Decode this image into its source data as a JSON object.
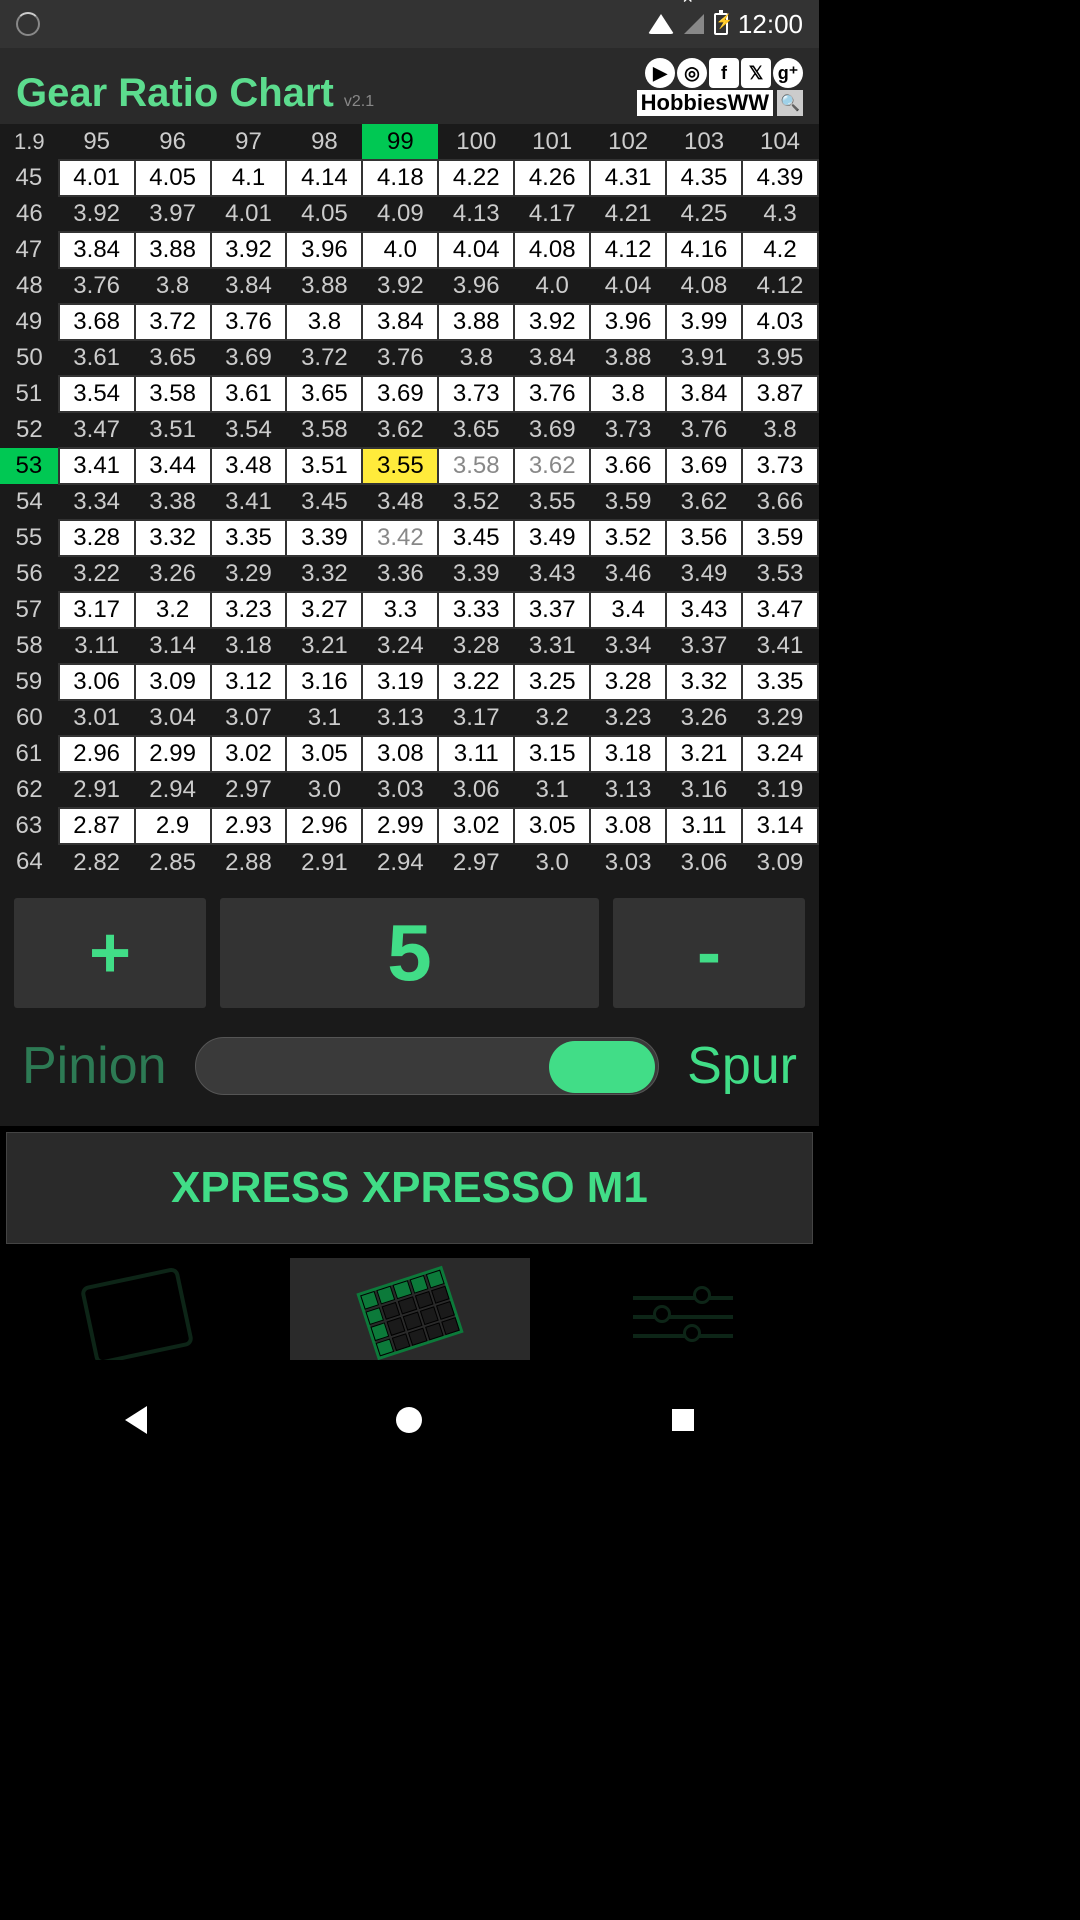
{
  "status": {
    "time": "12:00"
  },
  "header": {
    "title": "Gear Ratio Chart",
    "version": "v2.1",
    "brand": "HobbiesWW"
  },
  "table": {
    "corner": "1.9",
    "col_headers": [
      "95",
      "96",
      "97",
      "98",
      "99",
      "100",
      "101",
      "102",
      "103",
      "104"
    ],
    "highlight_col": 4,
    "row_headers": [
      "45",
      "46",
      "47",
      "48",
      "49",
      "50",
      "51",
      "52",
      "53",
      "54",
      "55",
      "56",
      "57",
      "58",
      "59",
      "60",
      "61",
      "62",
      "63",
      "64"
    ],
    "highlight_row": 8,
    "yellow_cell": {
      "row": 8,
      "col": 4
    },
    "gray_cells": [
      {
        "row": 8,
        "col": 5
      },
      {
        "row": 8,
        "col": 6
      },
      {
        "row": 10,
        "col": 4
      }
    ],
    "data": [
      [
        "4.01",
        "4.05",
        "4.1",
        "4.14",
        "4.18",
        "4.22",
        "4.26",
        "4.31",
        "4.35",
        "4.39"
      ],
      [
        "3.92",
        "3.97",
        "4.01",
        "4.05",
        "4.09",
        "4.13",
        "4.17",
        "4.21",
        "4.25",
        "4.3"
      ],
      [
        "3.84",
        "3.88",
        "3.92",
        "3.96",
        "4.0",
        "4.04",
        "4.08",
        "4.12",
        "4.16",
        "4.2"
      ],
      [
        "3.76",
        "3.8",
        "3.84",
        "3.88",
        "3.92",
        "3.96",
        "4.0",
        "4.04",
        "4.08",
        "4.12"
      ],
      [
        "3.68",
        "3.72",
        "3.76",
        "3.8",
        "3.84",
        "3.88",
        "3.92",
        "3.96",
        "3.99",
        "4.03"
      ],
      [
        "3.61",
        "3.65",
        "3.69",
        "3.72",
        "3.76",
        "3.8",
        "3.84",
        "3.88",
        "3.91",
        "3.95"
      ],
      [
        "3.54",
        "3.58",
        "3.61",
        "3.65",
        "3.69",
        "3.73",
        "3.76",
        "3.8",
        "3.84",
        "3.87"
      ],
      [
        "3.47",
        "3.51",
        "3.54",
        "3.58",
        "3.62",
        "3.65",
        "3.69",
        "3.73",
        "3.76",
        "3.8"
      ],
      [
        "3.41",
        "3.44",
        "3.48",
        "3.51",
        "3.55",
        "3.58",
        "3.62",
        "3.66",
        "3.69",
        "3.73"
      ],
      [
        "3.34",
        "3.38",
        "3.41",
        "3.45",
        "3.48",
        "3.52",
        "3.55",
        "3.59",
        "3.62",
        "3.66"
      ],
      [
        "3.28",
        "3.32",
        "3.35",
        "3.39",
        "3.42",
        "3.45",
        "3.49",
        "3.52",
        "3.56",
        "3.59"
      ],
      [
        "3.22",
        "3.26",
        "3.29",
        "3.32",
        "3.36",
        "3.39",
        "3.43",
        "3.46",
        "3.49",
        "3.53"
      ],
      [
        "3.17",
        "3.2",
        "3.23",
        "3.27",
        "3.3",
        "3.33",
        "3.37",
        "3.4",
        "3.43",
        "3.47"
      ],
      [
        "3.11",
        "3.14",
        "3.18",
        "3.21",
        "3.24",
        "3.28",
        "3.31",
        "3.34",
        "3.37",
        "3.41"
      ],
      [
        "3.06",
        "3.09",
        "3.12",
        "3.16",
        "3.19",
        "3.22",
        "3.25",
        "3.28",
        "3.32",
        "3.35"
      ],
      [
        "3.01",
        "3.04",
        "3.07",
        "3.1",
        "3.13",
        "3.17",
        "3.2",
        "3.23",
        "3.26",
        "3.29"
      ],
      [
        "2.96",
        "2.99",
        "3.02",
        "3.05",
        "3.08",
        "3.11",
        "3.15",
        "3.18",
        "3.21",
        "3.24"
      ],
      [
        "2.91",
        "2.94",
        "2.97",
        "3.0",
        "3.03",
        "3.06",
        "3.1",
        "3.13",
        "3.16",
        "3.19"
      ],
      [
        "2.87",
        "2.9",
        "2.93",
        "2.96",
        "2.99",
        "3.02",
        "3.05",
        "3.08",
        "3.11",
        "3.14"
      ],
      [
        "2.82",
        "2.85",
        "2.88",
        "2.91",
        "2.94",
        "2.97",
        "3.0",
        "3.03",
        "3.06",
        "3.09"
      ]
    ]
  },
  "controls": {
    "plus": "+",
    "value": "5",
    "minus": "-"
  },
  "slider": {
    "pinion": "Pinion",
    "spur": "Spur"
  },
  "car": {
    "name": "XPRESS XPRESSO M1"
  }
}
